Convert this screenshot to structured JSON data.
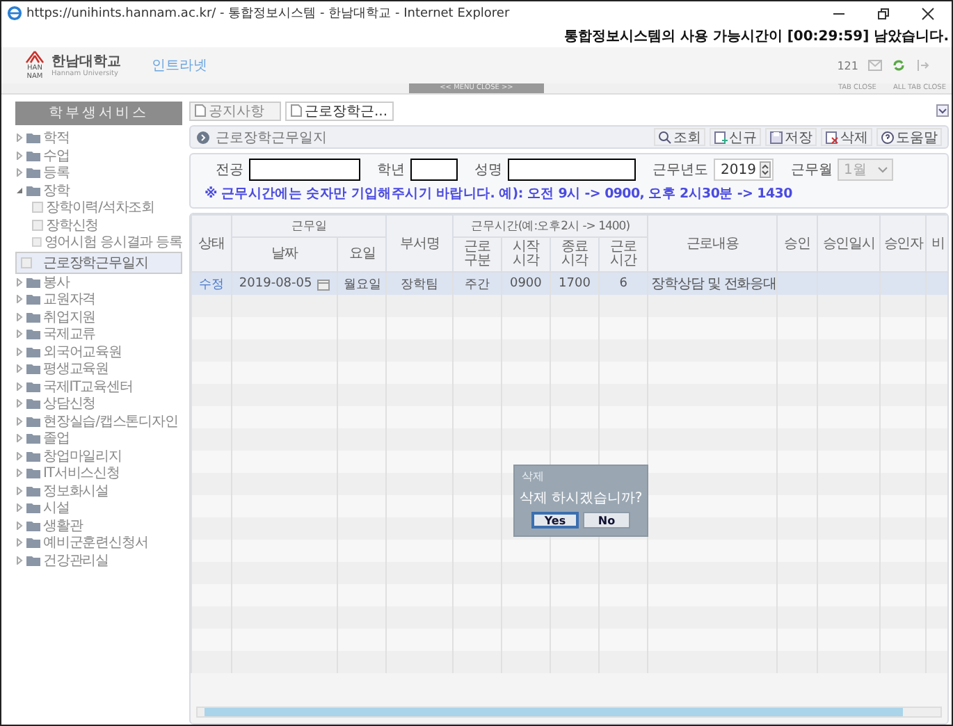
{
  "browser": {
    "title": "https://unihints.hannam.ac.kr/ - 통합정보시스템 - 한남대학교 - Internet Explorer"
  },
  "session_notice": "통합정보시스템의 사용 가능시간이 [00:29:59] 남았습니다.",
  "header": {
    "logo_mark": [
      "HAN",
      "NAM"
    ],
    "logo_text": "한남대학교",
    "logo_subtitle": "Hannam University",
    "intranet": "인트라넷",
    "count": "121"
  },
  "menu_bar": {
    "menu_close": "<< MENU CLOSE >>",
    "tab_close": "TAB CLOSE",
    "all_tab_close": "ALL TAB CLOSE"
  },
  "sidebar": {
    "title": "학부생서비스",
    "items": [
      {
        "label": "학적",
        "expanded": false
      },
      {
        "label": "수업",
        "expanded": false
      },
      {
        "label": "등록",
        "expanded": false
      },
      {
        "label": "장학",
        "expanded": true,
        "children": [
          {
            "label": "장학이력/석차조회",
            "selected": false
          },
          {
            "label": "장학신청",
            "selected": false
          },
          {
            "label": "영어시험 응시결과 등록",
            "selected": false
          },
          {
            "label": "근로장학근무일지",
            "selected": true
          }
        ]
      },
      {
        "label": "봉사",
        "expanded": false
      },
      {
        "label": "교원자격",
        "expanded": false
      },
      {
        "label": "취업지원",
        "expanded": false
      },
      {
        "label": "국제교류",
        "expanded": false
      },
      {
        "label": "외국어교육원",
        "expanded": false
      },
      {
        "label": "평생교육원",
        "expanded": false
      },
      {
        "label": "국제IT교육센터",
        "expanded": false
      },
      {
        "label": "상담신청",
        "expanded": false
      },
      {
        "label": "현장실습/캡스톤디자인",
        "expanded": false
      },
      {
        "label": "졸업",
        "expanded": false
      },
      {
        "label": "창업마일리지",
        "expanded": false
      },
      {
        "label": "IT서비스신청",
        "expanded": false
      },
      {
        "label": "정보화시설",
        "expanded": false
      },
      {
        "label": "시설",
        "expanded": false
      },
      {
        "label": "생활관",
        "expanded": false
      },
      {
        "label": "예비군훈련신청서",
        "expanded": false
      },
      {
        "label": "건강관리실",
        "expanded": false
      }
    ]
  },
  "tabs": [
    {
      "label": "공지사항",
      "selected": false
    },
    {
      "label": "근로장학근...",
      "selected": true
    }
  ],
  "page": {
    "title": "근로장학근무일지",
    "toolbar": [
      {
        "label": "조회",
        "kind": "search"
      },
      {
        "label": "신규",
        "kind": "new"
      },
      {
        "label": "저장",
        "kind": "save"
      },
      {
        "label": "삭제",
        "kind": "delete"
      },
      {
        "label": "도움말",
        "kind": "help"
      }
    ],
    "fields": [
      {
        "label": "전공",
        "kind": "text"
      },
      {
        "label": "학년",
        "kind": "text"
      },
      {
        "label": "성명",
        "kind": "text"
      },
      {
        "label": "근무년도",
        "kind": "spinner",
        "value": "2019"
      },
      {
        "label": "근무월",
        "kind": "select",
        "value": "1월",
        "disabled": true
      }
    ],
    "notice": "※ 근무시간에는 숫자만 기입해주시기 바랍니다. 예): 오전 9시 -> 0900, 오후 2시30분 -> 1430"
  },
  "table": {
    "columns": [
      {
        "label": "상태"
      },
      {
        "label": "근무일",
        "colspan": 2,
        "children": [
          "날짜",
          "요일"
        ]
      },
      {
        "label": "부서명"
      },
      {
        "label": "근무시간(예:오후2시 -> 1400)",
        "colspan": 4,
        "children": [
          "근로\n구분",
          "시작\n시각",
          "종료\n시각",
          "근로\n시간"
        ]
      },
      {
        "label": "근로내용"
      },
      {
        "label": "승인"
      },
      {
        "label": "승인일시"
      },
      {
        "label": "승인자"
      },
      {
        "label": "비"
      }
    ],
    "rows": [
      {
        "selected": true,
        "cells": [
          "수정",
          "2019-08-05",
          "월요일",
          "장학팀",
          "주간",
          "0900",
          "1700",
          "6",
          "장학상담 및 전화응대",
          "",
          "",
          "",
          ""
        ]
      }
    ]
  },
  "dialog": {
    "title": "삭제",
    "message": "삭제 하시겠습니까?",
    "buttons": [
      {
        "label": "Yes",
        "selected": true
      },
      {
        "label": "No",
        "selected": false
      }
    ]
  }
}
